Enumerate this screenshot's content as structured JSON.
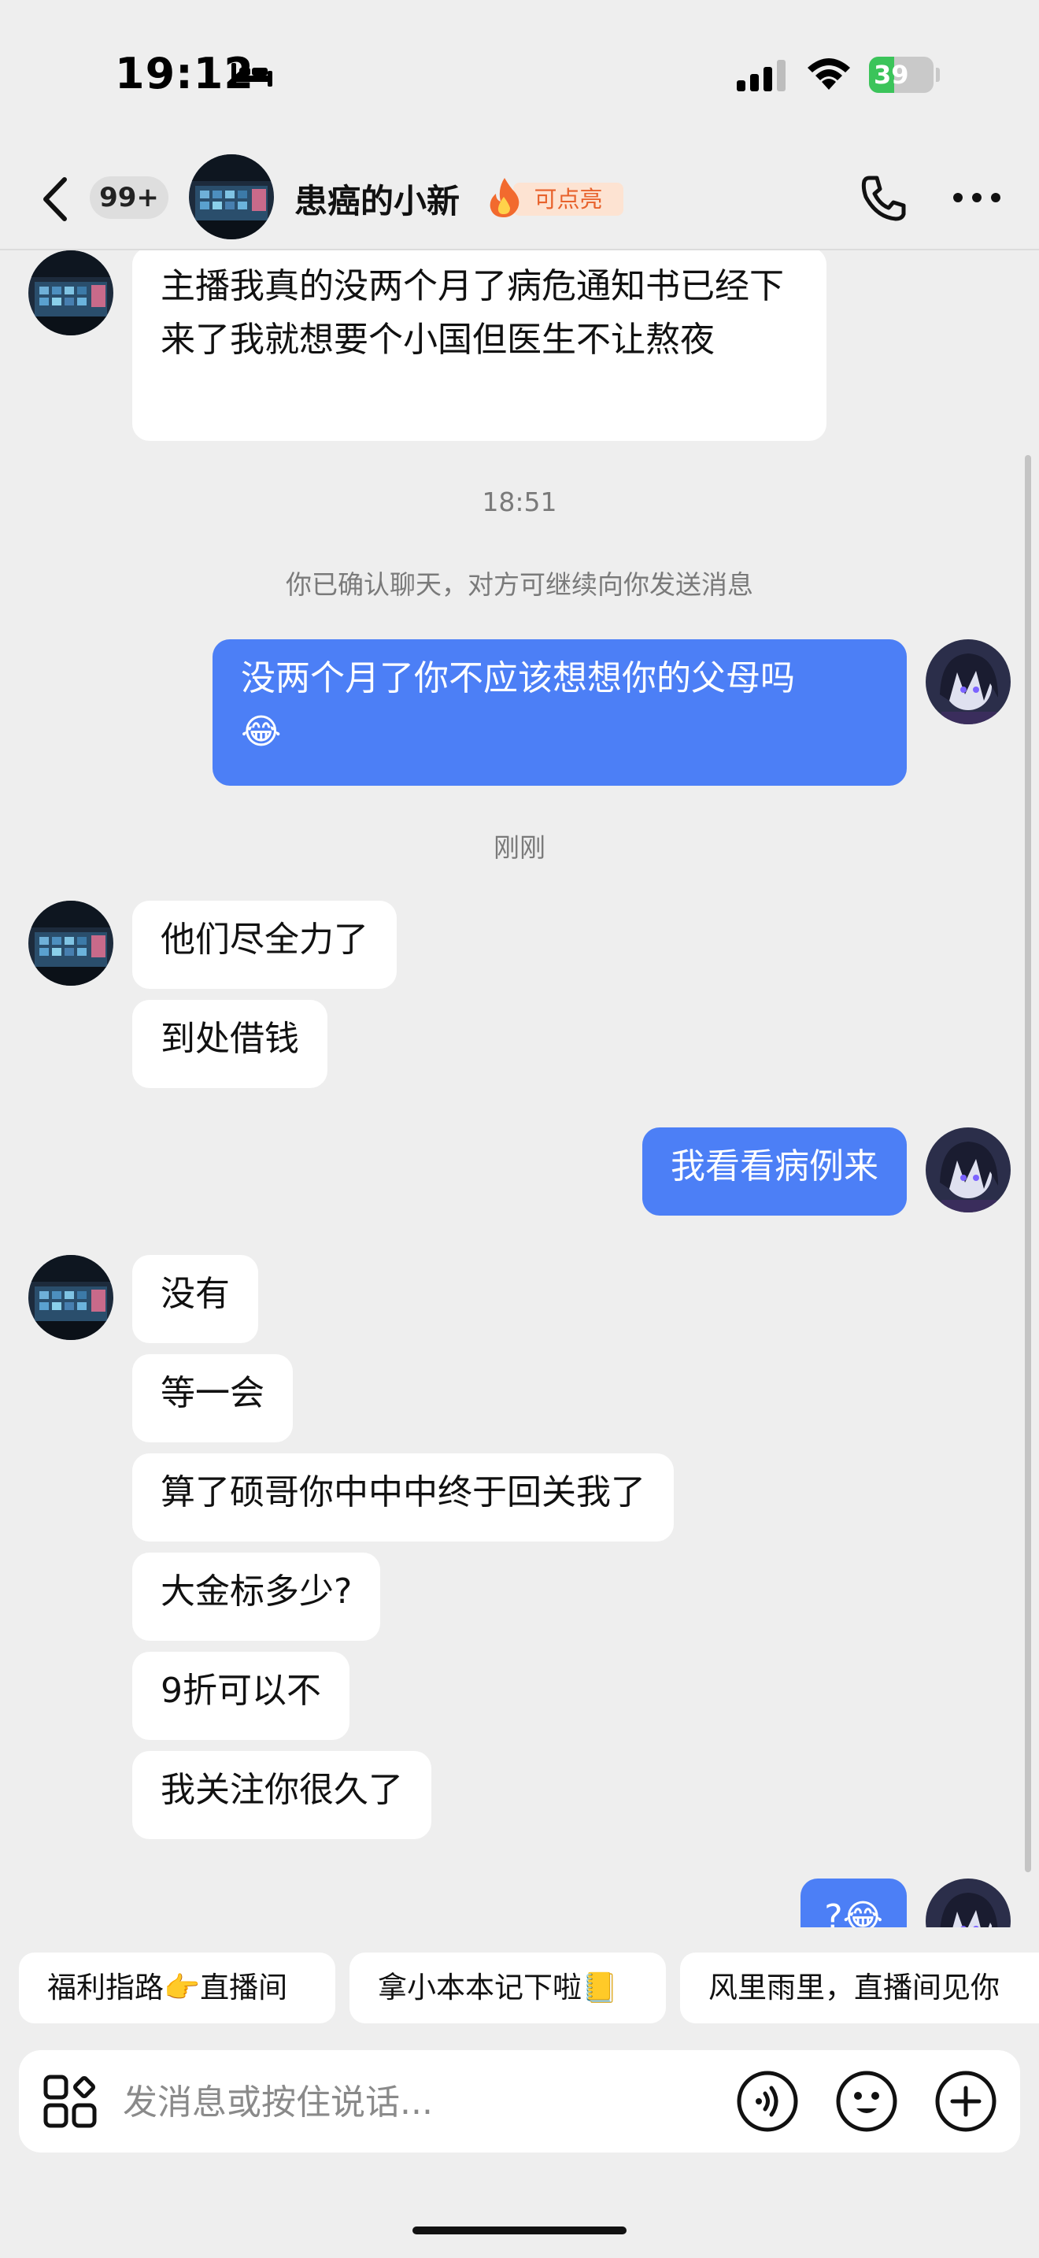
{
  "status_bar": {
    "time": "19:12",
    "battery": "39",
    "battery_level": 0.39,
    "icons": [
      "bed-icon",
      "signal-icon",
      "wifi-icon",
      "battery-icon"
    ]
  },
  "header": {
    "unread_count": "99+",
    "contact_name": "患癌的小新",
    "flame_label": "可点亮",
    "icons": [
      "back-icon",
      "flame-icon",
      "phone-icon",
      "more-icon"
    ]
  },
  "chat": {
    "msg_1": "主播我真的没两个月了病危通知书已经下来了我就想要个小国但医生不让熬夜",
    "time_1": "18:51",
    "system_notice": "你已确认聊天，对方可继续向你发送消息",
    "msg_2": "没两个月了你不应该想想你的父母吗",
    "msg_2_emoji": "😂",
    "time_2": "刚刚",
    "msg_3": "他们尽全力了",
    "msg_4": "到处借钱",
    "msg_5": "我看看病例来",
    "msg_6": "没有",
    "msg_7": "等一会",
    "msg_8": "算了硕哥你中中中终于回关我了",
    "msg_9": "大金标多少?",
    "msg_10": "9折可以不",
    "msg_11": "我关注你很久了",
    "msg_12": "?",
    "msg_12_emoji": "😂"
  },
  "quick_replies": {
    "chip_1": "福利指路👉直播间",
    "chip_2": "拿小本本记下啦📒",
    "chip_3": "风里雨里，直播间见你"
  },
  "input": {
    "placeholder": "发消息或按住说话...",
    "icons": [
      "apps-icon",
      "voice-icon",
      "emoji-icon",
      "plus-icon"
    ]
  },
  "colors": {
    "background": "#eeeeee",
    "outgoing_bubble": "#4c7ff6",
    "incoming_bubble": "#ffffff",
    "flame_tag_bg": "#fde3d2",
    "flame_tag_text": "#e8622c",
    "battery_green": "#3bc45a"
  }
}
